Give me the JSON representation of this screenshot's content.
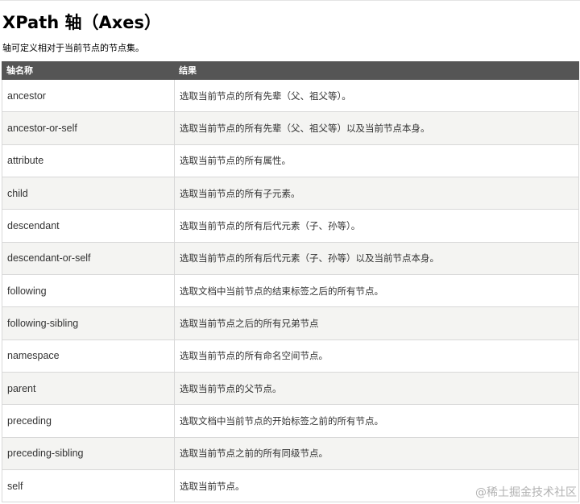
{
  "title": "XPath 轴（Axes）",
  "intro": "轴可定义相对于当前节点的节点集。",
  "table": {
    "headers": [
      "轴名称",
      "结果"
    ],
    "rows": [
      {
        "axis": "ancestor",
        "result": "选取当前节点的所有先辈（父、祖父等）。"
      },
      {
        "axis": "ancestor-or-self",
        "result": "选取当前节点的所有先辈（父、祖父等）以及当前节点本身。"
      },
      {
        "axis": "attribute",
        "result": "选取当前节点的所有属性。"
      },
      {
        "axis": "child",
        "result": "选取当前节点的所有子元素。"
      },
      {
        "axis": "descendant",
        "result": "选取当前节点的所有后代元素（子、孙等）。"
      },
      {
        "axis": "descendant-or-self",
        "result": "选取当前节点的所有后代元素（子、孙等）以及当前节点本身。"
      },
      {
        "axis": "following",
        "result": "选取文档中当前节点的结束标签之后的所有节点。"
      },
      {
        "axis": "following-sibling",
        "result": "选取当前节点之后的所有兄弟节点"
      },
      {
        "axis": "namespace",
        "result": "选取当前节点的所有命名空间节点。"
      },
      {
        "axis": "parent",
        "result": "选取当前节点的父节点。"
      },
      {
        "axis": "preceding",
        "result": "选取文档中当前节点的开始标签之前的所有节点。"
      },
      {
        "axis": "preceding-sibling",
        "result": "选取当前节点之前的所有同级节点。"
      },
      {
        "axis": "self",
        "result": "选取当前节点。"
      }
    ]
  },
  "watermark": "@稀土掘金技术社区"
}
